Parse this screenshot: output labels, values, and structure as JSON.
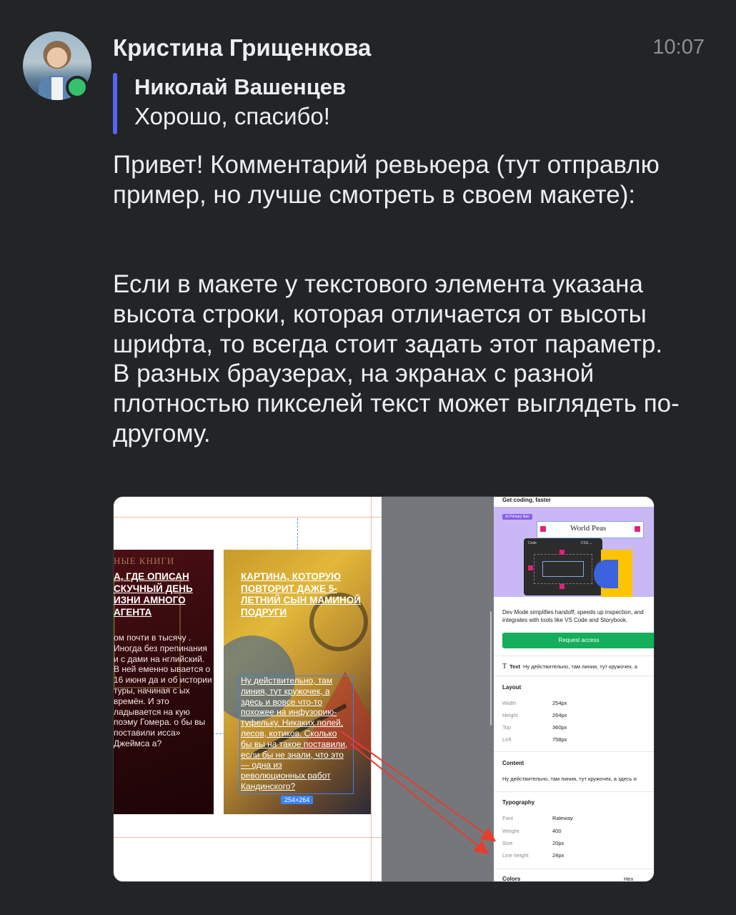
{
  "message": {
    "sender": "Кристина Грищенкова",
    "time": "10:07",
    "reply": {
      "author": "Николай Вашенцев",
      "text": "Хорошо, спасибо!"
    },
    "paragraph1": "Привет! Комментарий ревьюера (тут отправлю пример, но лучше смотреть в своем макете):",
    "paragraph2": "Если в макете у текстового элемента указана высота строки, которая отличается от высоты шрифта, то всегда стоит задать этот параметр. В разных браузерах, на экранах с разной плотностью пикселей текст может выглядеть по-другому."
  },
  "attachment": {
    "left_card": {
      "brand": "НЫЕ  КНИГИ",
      "title": "А, ГДЕ ОПИСАН СКУЧНЫЙ ДЕНЬ ИЗНИ АМНОГО АГЕНТА",
      "body": "ом почти в тысячу . Иногда без препинания и с дами на нглийский. В ней еменно ывается о 16 июня да и об истории туры, начиная с ых времён. И это ладывается на кую поэму Гомера. о бы вы поставили исса» Джеймса а?"
    },
    "right_card": {
      "title": "КАРТИНА, КОТОРУЮ ПОВТОРИТ ДАЖЕ 5-ЛЕТНИЙ СЫН МАМИНОЙ ПОДРУГИ",
      "body": "Ну действительно, там линия, тут кружочек, а здесь и вовсе что-то похожее на инфузорию-туфельку. Никаких полей, лесов, котиков. Сколько бы вы на такое поставили, если бы не знали, что это — одна из революционных работ Кандинского?",
      "size_badge": "254×264"
    },
    "dev_panel": {
      "heading": "Get coding, faster",
      "promo_tag": "AI Primary Nav",
      "promo_word": "World Peas",
      "promo_code_title": "Code",
      "promo_code_lang": "CSS ⌄",
      "description": "Dev Mode simplifies handoff, speeds up inspection, and integrates with tools like VS Code and Storybook.",
      "request_button": "Request access",
      "text_label": "Text",
      "text_value": "Ну действительно, там линия, тут кружочек, а",
      "layout_title": "Layout",
      "layout": [
        {
          "label": "Width",
          "value": "254px"
        },
        {
          "label": "Height",
          "value": "264px"
        },
        {
          "label": "Top",
          "value": "360px"
        },
        {
          "label": "Left",
          "value": "758px"
        }
      ],
      "content_title": "Content",
      "content_value": "Ну действительно, там линия, тут кружочек, а здесь и",
      "typography_title": "Typography",
      "typography": [
        {
          "label": "Font",
          "value": "Raleway"
        },
        {
          "label": "Weight",
          "value": "400"
        },
        {
          "label": "Size",
          "value": "20px"
        },
        {
          "label": "Line height",
          "value": "24px"
        }
      ],
      "colors_title": "Colors",
      "colors_format": "Hex"
    }
  },
  "colors": {
    "background": "#222426",
    "text": "#eceef0",
    "muted": "#8c9096",
    "reply_bar": "#5865f2",
    "online": "#36c26c",
    "selection": "#3b82f6",
    "arrow": "#e53e2f",
    "request_button": "#14ae5c"
  }
}
